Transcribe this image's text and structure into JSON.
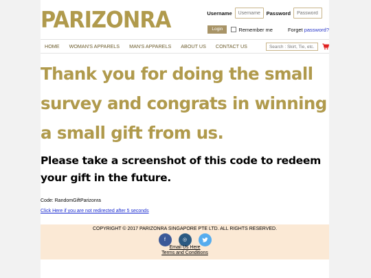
{
  "brand": {
    "logo_text": "PARIZONRA",
    "color": "#b09a4c"
  },
  "login": {
    "username_label": "Username",
    "username_placeholder": "Username",
    "password_label": "Password",
    "password_placeholder": "Password",
    "login_button": "Login",
    "remember_label": "Remember me",
    "forgot_prefix": "Forget ",
    "forgot_link": "password?"
  },
  "nav": {
    "items": [
      "HOME",
      "WOMAN'S APPARELS",
      "MAN'S APPARELS",
      "ABOUT US",
      "CONTACT US"
    ],
    "search_value": "Search :   Skirt, Tie, etc.",
    "cart_icon": "cart-icon"
  },
  "main": {
    "thanks": "Thank you for doing the small survey and congrats in winning a small gift from us.",
    "instruction": "Please take a screenshot of this code to redeem your gift in the future.",
    "code": "Code: RandomGiftParizonra",
    "redirect_link": "Click Here if you are not redirected after 5 seconds"
  },
  "footer": {
    "copyright": "COPYRIGHT © 2017 PARIZONRA SINGAPORE PTE LTD. ALL RIGHTS RESERVED.",
    "socials": [
      {
        "name": "facebook-icon",
        "glyph": "f",
        "color": "#3b5998"
      },
      {
        "name": "instagram-icon",
        "glyph": "◎",
        "color": "#2c5a82"
      },
      {
        "name": "twitter-icon",
        "glyph": "🐦",
        "color": "#55acee"
      }
    ],
    "email_link": "Email Us Here",
    "terms_link": "Terms and Conditions",
    "background": "#fbe9d5"
  }
}
